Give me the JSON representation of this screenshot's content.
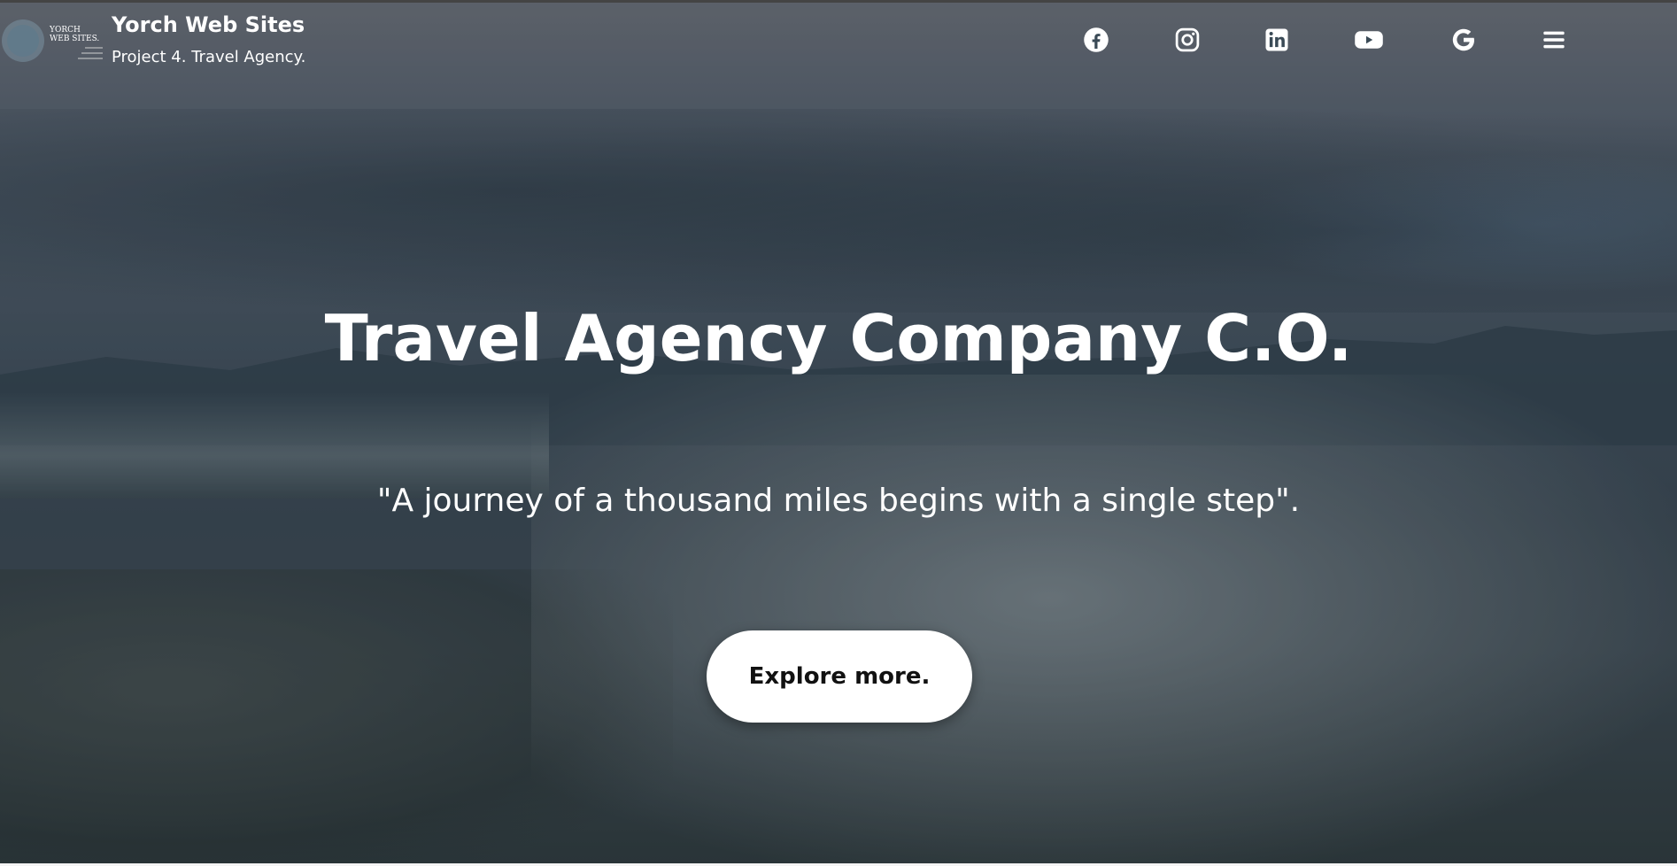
{
  "brand": {
    "logo_text_line1": "YORCH",
    "logo_text_line2": "WEB SITES.",
    "title": "Yorch Web Sites",
    "subtitle": "Project 4. Travel Agency."
  },
  "social": [
    {
      "icon": "facebook-icon"
    },
    {
      "icon": "instagram-icon"
    },
    {
      "icon": "linkedin-icon"
    },
    {
      "icon": "youtube-icon"
    },
    {
      "icon": "google-icon"
    },
    {
      "icon": "menu-icon"
    }
  ],
  "hero": {
    "headline": "Travel Agency Company C.O.",
    "quote": "\"A journey of a thousand miles begins with a single step\".",
    "cta_label": "Explore more."
  },
  "colors": {
    "text": "#ffffff",
    "button_bg": "#ffffff",
    "button_text": "#111111"
  }
}
